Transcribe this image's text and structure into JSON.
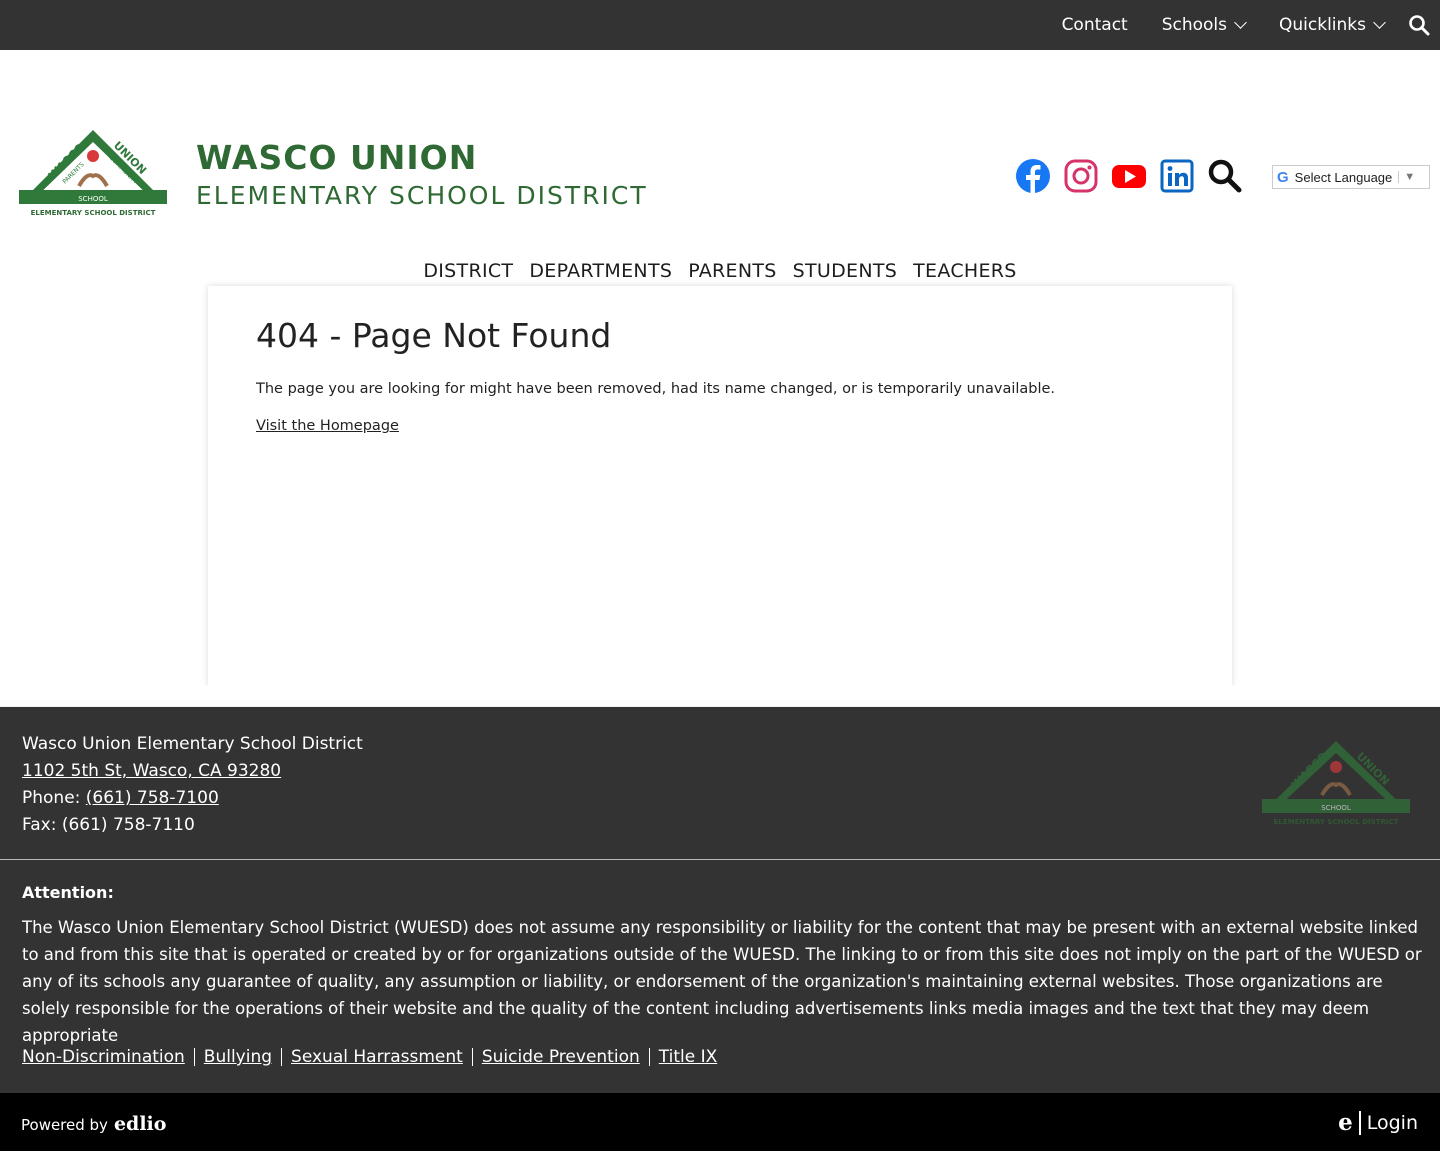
{
  "topbar": {
    "contact": "Contact",
    "schools": "Schools",
    "quicklinks": "Quicklinks"
  },
  "brand": {
    "line1": "WASCO UNION",
    "line2": "ELEMENTARY SCHOOL DISTRICT",
    "logo_text": [
      "WASCO",
      "UNION",
      "PARENTS",
      "COMMUNITY",
      "SCHOOL",
      "ELEMENTARY SCHOOL DISTRICT"
    ]
  },
  "social": [
    "facebook-icon",
    "instagram-icon",
    "youtube-icon",
    "linkedin-icon",
    "search-icon"
  ],
  "translate": {
    "label": "Select Language"
  },
  "nav": [
    "DISTRICT",
    "DEPARTMENTS",
    "PARENTS",
    "STUDENTS",
    "TEACHERS"
  ],
  "content": {
    "title": "404 - Page Not Found",
    "message": "The page you are looking for might have been removed, had its name changed, or is temporarily unavailable.",
    "link": "Visit the Homepage"
  },
  "footer": {
    "name": "Wasco Union Elementary School District",
    "address": "1102 5th St, Wasco, CA 93280",
    "phone_label": "Phone:",
    "phone": "(661) 758-7100",
    "fax": "Fax: (661) 758-7110",
    "attention_title": "Attention:",
    "attention_body": "The Wasco Union Elementary School District (WUESD) does not assume any responsibility or liability for the content that may be present with an external website linked to and from this site that is operated or created by or for organizations outside of the WUESD. The linking to or from this site does not imply on the part of the WUESD or any of its schools any guarantee of quality, any assumption or liability, or endorsement of the organization's maintaining external websites. Those organizations are solely responsible for the operations of their website and the quality of the content including advertisements links media images and the text that they may deem appropriate",
    "links": [
      "Non-Discrimination",
      "Bullying",
      "Sexual Harrassment",
      "Suicide Prevention",
      "Title IX"
    ]
  },
  "bottom": {
    "powered": "Powered by",
    "edlio": "edlio",
    "login": "Login"
  },
  "colors": {
    "brand_green": "#2f6a34",
    "dark_bar": "#333333"
  }
}
